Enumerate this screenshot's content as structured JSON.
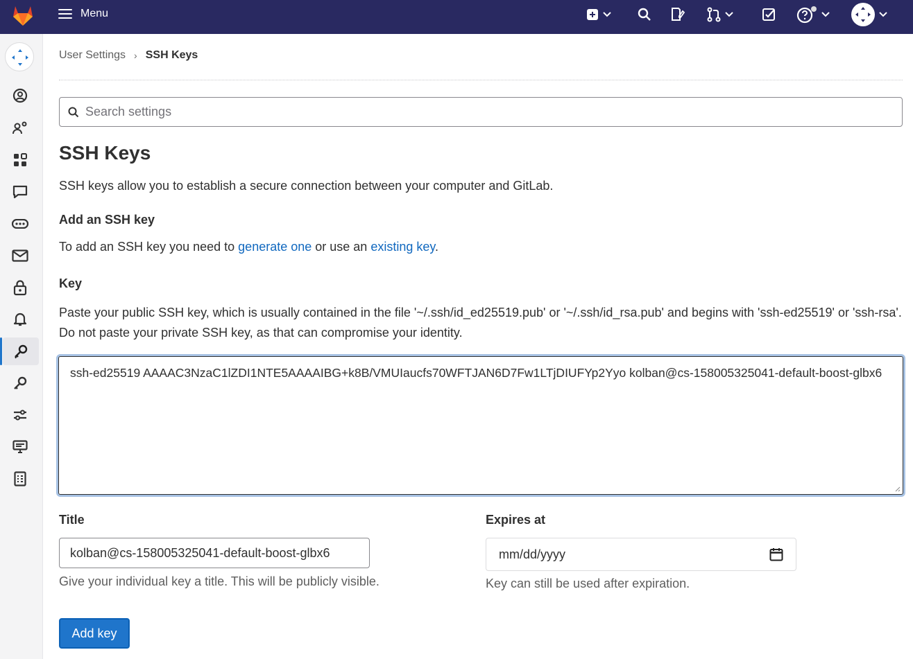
{
  "topbar": {
    "menu_label": "Menu",
    "icons": [
      "gitlab-logo-icon",
      "plus-square-icon",
      "search-icon",
      "issues-icon",
      "merge-request-icon",
      "todo-check-icon",
      "help-icon",
      "avatar-icon"
    ],
    "bg_color": "#292961"
  },
  "sidebar": {
    "items": [
      "profile-icon",
      "account-icon",
      "applications-icon",
      "chat-icon",
      "access-tokens-icon",
      "emails-icon",
      "password-icon",
      "notifications-icon",
      "ssh-keys-icon",
      "gpg-keys-icon",
      "preferences-icon",
      "active-sessions-icon",
      "authentication-log-icon"
    ],
    "active_item": "ssh-keys-icon"
  },
  "breadcrumb": {
    "parent": "User Settings",
    "separator": "›",
    "current": "SSH Keys"
  },
  "search": {
    "placeholder": "Search settings"
  },
  "page": {
    "title": "SSH Keys",
    "intro": "SSH keys allow you to establish a secure connection between your computer and GitLab."
  },
  "add_section": {
    "heading": "Add an SSH key",
    "text_before": "To add an SSH key you need to ",
    "link1": "generate one",
    "text_middle": " or use an ",
    "link2": "existing key",
    "text_after": "."
  },
  "key_field": {
    "label": "Key",
    "help": "Paste your public SSH key, which is usually contained in the file '~/.ssh/id_ed25519.pub' or '~/.ssh/id_rsa.pub' and begins with 'ssh-ed25519' or 'ssh-rsa'. Do not paste your private SSH key, as that can compromise your identity.",
    "value": "ssh-ed25519 AAAAC3NzaC1lZDI1NTE5AAAAIBG+k8B/VMUIaucfs70WFTJAN6D7Fw1LTjDIUFYp2Yyo kolban@cs-158005325041-default-boost-glbx6\n"
  },
  "title_field": {
    "label": "Title",
    "value": "kolban@cs-158005325041-default-boost-glbx6",
    "help": "Give your individual key a title. This will be publicly visible."
  },
  "expires_field": {
    "label": "Expires at",
    "placeholder": "mm/dd/yyyy",
    "help": "Key can still be used after expiration."
  },
  "submit": {
    "label": "Add key",
    "color": "#1f75cb"
  }
}
